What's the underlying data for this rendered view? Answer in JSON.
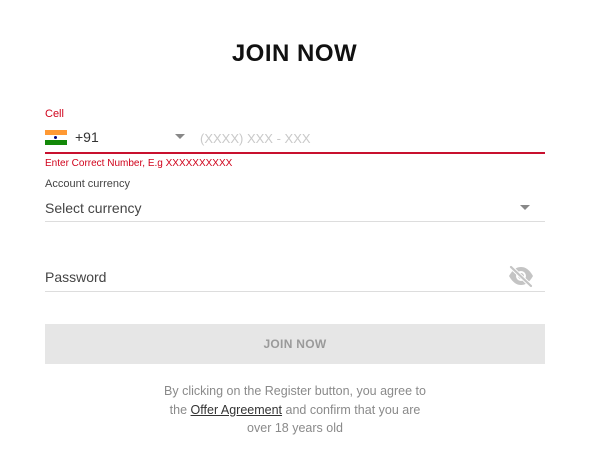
{
  "page": {
    "title": "JOIN NOW"
  },
  "form": {
    "cell": {
      "label": "Cell",
      "country_flag": "india-flag-icon",
      "dial_code": "+91",
      "placeholder": "(XXXX) XXX - XXX",
      "value": "",
      "error": "Enter Correct Number, E.g XXXXXXXXXX"
    },
    "currency": {
      "label": "Account currency",
      "selected": "Select currency"
    },
    "password": {
      "placeholder": "Password",
      "value": "",
      "visibility_icon": "eye-slash-icon"
    },
    "submit": {
      "label": "JOIN NOW"
    },
    "agreement": {
      "line1": "By clicking on the Register button, you agree to",
      "line2_pre": "the",
      "link": "Offer Agreement",
      "line2_post": "and confirm that you are",
      "line3": "over 18 years old"
    }
  },
  "colors": {
    "error": "#d0021b",
    "underline_error": "#c8102e",
    "button_bg": "#e6e6e6",
    "button_text": "#9a9a9a",
    "divider": "#dddddd"
  }
}
